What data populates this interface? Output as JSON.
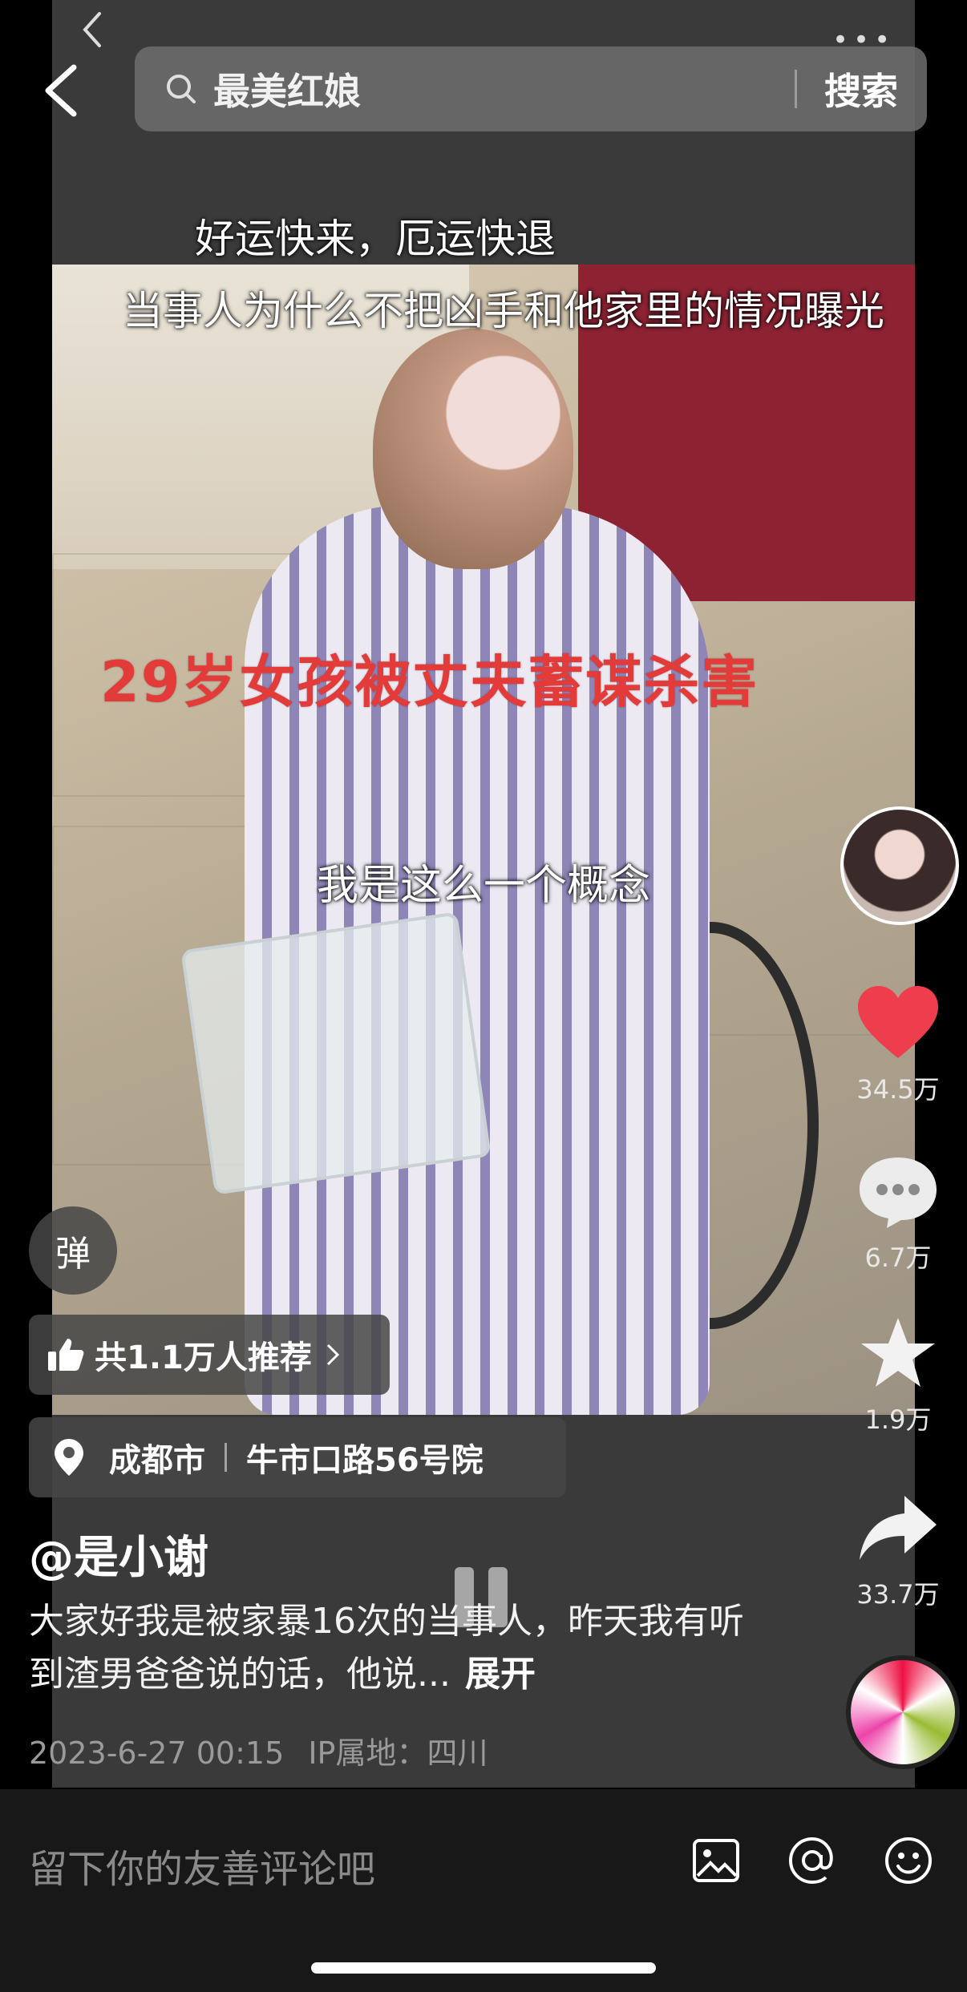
{
  "search": {
    "placeholder": "最美红娘",
    "button_label": "搜索"
  },
  "video": {
    "caption_top_1": "好运快来，厄运快退",
    "caption_top_2": "当事人为什么不把凶手和他家里的情况曝光",
    "title_overlay": "29岁女孩被丈夫蓄谋杀害",
    "subtitle": "我是这么一个概念"
  },
  "rail": {
    "like_count": "34.5万",
    "comment_count": "6.7万",
    "favorite_count": "1.9万",
    "share_count": "33.7万",
    "like_color": "#ee3e4e"
  },
  "danmu_label": "弹",
  "recommend": {
    "label": "共1.1万人推荐"
  },
  "location": {
    "city": "成都市",
    "place": "牛市口路56号院"
  },
  "post": {
    "author": "@是小谢",
    "description": "大家好我是被家暴16次的当事人，昨天我有听到渣男爸爸说的话，他说...",
    "expand_label": "展开",
    "date": "2023-6-27 00:15",
    "ip": "IP属地：四川"
  },
  "comment_bar": {
    "placeholder": "留下你的友善评论吧"
  }
}
